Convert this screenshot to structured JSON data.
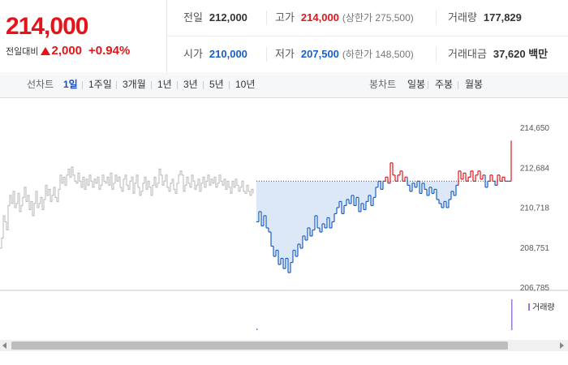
{
  "quote": {
    "current_price": "214,000",
    "change_label": "전일대비",
    "change_amount": "2,000",
    "change_percent": "+0.94%",
    "prev_close": {
      "label": "전일",
      "value": "212,000"
    },
    "high": {
      "label": "고가",
      "value": "214,000",
      "limit": "(상한가 275,500)"
    },
    "volume": {
      "label": "거래량",
      "value": "177,829"
    },
    "open": {
      "label": "시가",
      "value": "210,000"
    },
    "low": {
      "label": "저가",
      "value": "207,500",
      "limit": "(하한가 148,500)"
    },
    "trade_value": {
      "label": "거래대금",
      "value": "37,620 백만"
    },
    "colors": {
      "up": "#e3151a",
      "down": "#1a5fc7"
    }
  },
  "tabs": {
    "line_label": "선차트",
    "line_periods": [
      "1일",
      "1주일",
      "3개월",
      "1년",
      "3년",
      "5년",
      "10년"
    ],
    "active_period": "1일",
    "candle_label": "봉차트",
    "candle_periods": [
      "일봉",
      "주봉",
      "월봉"
    ]
  },
  "chart_data": {
    "type": "line",
    "y_ticks": [
      "214,650",
      "212,684",
      "210,718",
      "208,751",
      "206,785"
    ],
    "ylim": [
      206785,
      214650
    ],
    "reference_price": 212000,
    "volume_legend": "거래량",
    "colors": {
      "above": "#e3151a",
      "below": "#1a5fc7",
      "previous_day": "#b8b8b8",
      "fill": "#dce8f7"
    },
    "previous_day": [
      [
        0,
        208700
      ],
      [
        2,
        209200
      ],
      [
        4,
        210300
      ],
      [
        6,
        210000
      ],
      [
        8,
        209600
      ],
      [
        10,
        210800
      ],
      [
        12,
        211300
      ],
      [
        14,
        210900
      ],
      [
        16,
        211500
      ],
      [
        18,
        210700
      ],
      [
        20,
        210900
      ],
      [
        22,
        211400
      ],
      [
        24,
        210500
      ],
      [
        26,
        210800
      ],
      [
        28,
        211200
      ],
      [
        30,
        211700
      ],
      [
        32,
        211000
      ],
      [
        34,
        211300
      ],
      [
        36,
        210600
      ],
      [
        38,
        211000
      ],
      [
        40,
        210300
      ],
      [
        42,
        210900
      ],
      [
        44,
        211500
      ],
      [
        46,
        210700
      ],
      [
        48,
        210900
      ],
      [
        50,
        211200
      ],
      [
        52,
        210600
      ],
      [
        54,
        211100
      ],
      [
        56,
        211800
      ],
      [
        58,
        211300
      ],
      [
        60,
        211600
      ],
      [
        62,
        211000
      ],
      [
        64,
        211300
      ],
      [
        66,
        211700
      ],
      [
        68,
        211200
      ],
      [
        70,
        211000
      ],
      [
        72,
        211600
      ],
      [
        74,
        212300
      ],
      [
        76,
        211900
      ],
      [
        78,
        212200
      ],
      [
        80,
        211800
      ],
      [
        82,
        212300
      ],
      [
        84,
        212600
      ],
      [
        86,
        212200
      ],
      [
        88,
        212700
      ],
      [
        90,
        212300
      ],
      [
        92,
        212000
      ],
      [
        94,
        211900
      ],
      [
        96,
        212400
      ],
      [
        98,
        212000
      ],
      [
        100,
        211700
      ],
      [
        102,
        212200
      ],
      [
        104,
        211600
      ],
      [
        106,
        212100
      ],
      [
        108,
        211800
      ],
      [
        110,
        212300
      ],
      [
        112,
        212000
      ],
      [
        114,
        211700
      ],
      [
        116,
        212100
      ],
      [
        118,
        211900
      ],
      [
        120,
        212200
      ],
      [
        122,
        211600
      ],
      [
        124,
        211800
      ],
      [
        126,
        212300
      ],
      [
        128,
        212000
      ],
      [
        130,
        211900
      ],
      [
        132,
        212200
      ],
      [
        134,
        211800
      ],
      [
        136,
        212400
      ],
      [
        138,
        211600
      ],
      [
        140,
        211900
      ],
      [
        142,
        212300
      ],
      [
        144,
        212000
      ],
      [
        146,
        212200
      ],
      [
        148,
        211700
      ],
      [
        150,
        211500
      ],
      [
        152,
        212100
      ],
      [
        154,
        212300
      ],
      [
        156,
        211800
      ],
      [
        158,
        211600
      ],
      [
        160,
        212000
      ],
      [
        162,
        212200
      ],
      [
        164,
        211400
      ],
      [
        166,
        211900
      ],
      [
        168,
        212300
      ],
      [
        170,
        211700
      ],
      [
        172,
        211300
      ],
      [
        174,
        211500
      ],
      [
        176,
        211900
      ],
      [
        178,
        212200
      ],
      [
        180,
        211600
      ],
      [
        182,
        212000
      ],
      [
        184,
        211700
      ],
      [
        186,
        211300
      ],
      [
        188,
        211800
      ],
      [
        190,
        212200
      ],
      [
        192,
        211700
      ],
      [
        194,
        211900
      ],
      [
        196,
        212600
      ],
      [
        198,
        212300
      ],
      [
        200,
        211800
      ],
      [
        202,
        212000
      ],
      [
        204,
        212300
      ],
      [
        206,
        211700
      ],
      [
        208,
        211500
      ],
      [
        210,
        211900
      ],
      [
        212,
        212100
      ],
      [
        214,
        211600
      ],
      [
        216,
        211400
      ],
      [
        218,
        211900
      ],
      [
        220,
        212300
      ],
      [
        222,
        212500
      ],
      [
        224,
        212300
      ],
      [
        226,
        211500
      ],
      [
        228,
        211800
      ],
      [
        230,
        212200
      ],
      [
        232,
        211900
      ],
      [
        234,
        211700
      ],
      [
        236,
        212300
      ],
      [
        238,
        212000
      ],
      [
        240,
        211600
      ],
      [
        242,
        211800
      ],
      [
        244,
        212100
      ],
      [
        246,
        211500
      ],
      [
        248,
        211900
      ],
      [
        250,
        212200
      ],
      [
        252,
        211700
      ],
      [
        254,
        212000
      ],
      [
        256,
        212300
      ],
      [
        258,
        211800
      ],
      [
        260,
        212100
      ],
      [
        262,
        211900
      ],
      [
        264,
        212200
      ],
      [
        266,
        211700
      ],
      [
        268,
        211900
      ],
      [
        270,
        212300
      ],
      [
        272,
        212000
      ],
      [
        274,
        211800
      ],
      [
        276,
        212100
      ],
      [
        278,
        211600
      ],
      [
        280,
        212000
      ],
      [
        282,
        211700
      ],
      [
        284,
        211400
      ],
      [
        286,
        212000
      ],
      [
        288,
        211700
      ],
      [
        290,
        212100
      ],
      [
        292,
        211800
      ],
      [
        294,
        211500
      ],
      [
        296,
        211700
      ],
      [
        298,
        212000
      ],
      [
        300,
        211500
      ],
      [
        302,
        211400
      ],
      [
        304,
        211800
      ],
      [
        306,
        211500
      ],
      [
        308,
        211300
      ],
      [
        310,
        211600
      ],
      [
        312,
        211400
      ]
    ],
    "today": [
      [
        316,
        210000
      ],
      [
        319,
        210500
      ],
      [
        322,
        209800
      ],
      [
        325,
        210300
      ],
      [
        328,
        209700
      ],
      [
        331,
        209500
      ],
      [
        334,
        208800
      ],
      [
        337,
        208300
      ],
      [
        340,
        208600
      ],
      [
        343,
        207900
      ],
      [
        346,
        208200
      ],
      [
        349,
        207700
      ],
      [
        352,
        208200
      ],
      [
        355,
        207500
      ],
      [
        358,
        208000
      ],
      [
        361,
        208600
      ],
      [
        364,
        208300
      ],
      [
        367,
        208900
      ],
      [
        370,
        208700
      ],
      [
        373,
        209300
      ],
      [
        376,
        209100
      ],
      [
        379,
        209700
      ],
      [
        382,
        209300
      ],
      [
        385,
        209600
      ],
      [
        388,
        210300
      ],
      [
        391,
        209700
      ],
      [
        394,
        209500
      ],
      [
        397,
        209900
      ],
      [
        400,
        209700
      ],
      [
        403,
        210200
      ],
      [
        406,
        209700
      ],
      [
        409,
        210000
      ],
      [
        412,
        210400
      ],
      [
        415,
        210700
      ],
      [
        418,
        211000
      ],
      [
        421,
        210400
      ],
      [
        424,
        210800
      ],
      [
        427,
        211100
      ],
      [
        430,
        210900
      ],
      [
        433,
        211300
      ],
      [
        436,
        210800
      ],
      [
        439,
        211200
      ],
      [
        442,
        210500
      ],
      [
        445,
        210900
      ],
      [
        448,
        210600
      ],
      [
        451,
        211000
      ],
      [
        454,
        211300
      ],
      [
        457,
        210800
      ],
      [
        460,
        211200
      ],
      [
        463,
        211700
      ],
      [
        466,
        212000
      ],
      [
        469,
        211600
      ],
      [
        472,
        212000
      ],
      [
        475,
        212200
      ],
      [
        478,
        211900
      ],
      [
        481,
        212900
      ],
      [
        484,
        212300
      ],
      [
        487,
        212000
      ],
      [
        490,
        212300
      ],
      [
        493,
        212500
      ],
      [
        496,
        212000
      ],
      [
        499,
        212200
      ],
      [
        502,
        211800
      ],
      [
        505,
        211500
      ],
      [
        508,
        211900
      ],
      [
        511,
        211700
      ],
      [
        514,
        212000
      ],
      [
        517,
        211400
      ],
      [
        520,
        211900
      ],
      [
        523,
        211600
      ],
      [
        526,
        211300
      ],
      [
        529,
        211700
      ],
      [
        532,
        211400
      ],
      [
        535,
        211600
      ],
      [
        538,
        211100
      ],
      [
        541,
        210900
      ],
      [
        544,
        210700
      ],
      [
        547,
        211000
      ],
      [
        550,
        210700
      ],
      [
        553,
        211100
      ],
      [
        556,
        211500
      ],
      [
        559,
        211300
      ],
      [
        562,
        211800
      ],
      [
        565,
        212500
      ],
      [
        568,
        212100
      ],
      [
        571,
        212400
      ],
      [
        574,
        212000
      ],
      [
        577,
        212200
      ],
      [
        580,
        212500
      ],
      [
        583,
        212000
      ],
      [
        586,
        212300
      ],
      [
        589,
        212500
      ],
      [
        592,
        212100
      ],
      [
        595,
        212300
      ],
      [
        598,
        211700
      ],
      [
        601,
        212000
      ],
      [
        604,
        212300
      ],
      [
        607,
        212000
      ],
      [
        610,
        211800
      ],
      [
        613,
        212300
      ],
      [
        616,
        212000
      ],
      [
        619,
        212200
      ],
      [
        622,
        212000
      ],
      [
        625,
        212000
      ],
      [
        628,
        212000
      ],
      [
        630,
        214000
      ]
    ],
    "volume_bars": [
      [
        316,
        2
      ],
      [
        630,
        38
      ]
    ]
  }
}
